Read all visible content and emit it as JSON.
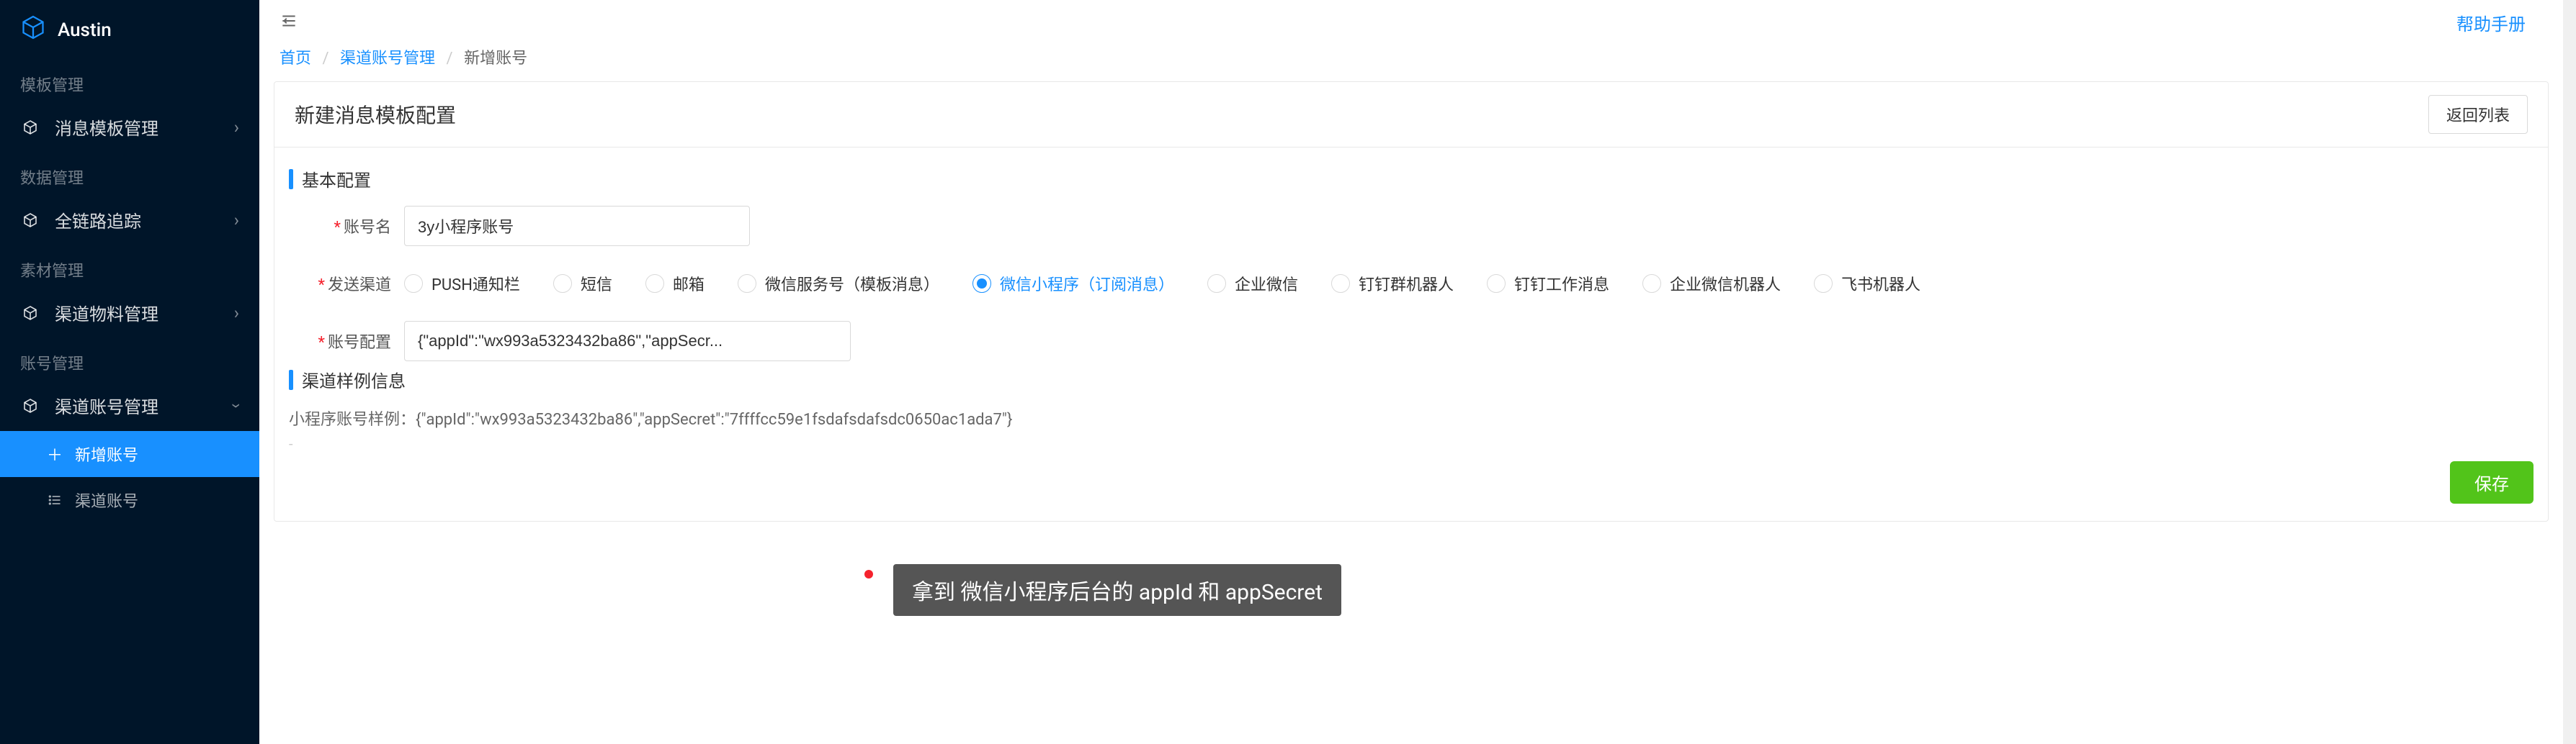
{
  "app_name": "Austin",
  "topbar": {
    "help": "帮助手册"
  },
  "breadcrumb": {
    "home": "首页",
    "mgmt": "渠道账号管理",
    "current": "新增账号"
  },
  "sidebar": {
    "groups": [
      {
        "label": "模板管理",
        "items": [
          {
            "icon": "cube",
            "label": "消息模板管理",
            "expandable": true
          }
        ]
      },
      {
        "label": "数据管理",
        "items": [
          {
            "icon": "cube",
            "label": "全链路追踪",
            "expandable": true
          }
        ]
      },
      {
        "label": "素材管理",
        "items": [
          {
            "icon": "cube",
            "label": "渠道物料管理",
            "expandable": true
          }
        ]
      },
      {
        "label": "账号管理",
        "items": [
          {
            "icon": "cube",
            "label": "渠道账号管理",
            "expandable": true,
            "expanded": true,
            "children": [
              {
                "icon": "plus",
                "label": "新增账号",
                "active": true
              },
              {
                "icon": "list",
                "label": "渠道账号"
              }
            ]
          }
        ]
      }
    ]
  },
  "panel": {
    "title": "新建消息模板配置",
    "back": "返回列表"
  },
  "form": {
    "section_basic": "基本配置",
    "account_name_label": "账号名",
    "account_name_value": "3y小程序账号",
    "channel_label": "发送渠道",
    "channels": [
      "PUSH通知栏",
      "短信",
      "邮箱",
      "微信服务号（模板消息）",
      "微信小程序（订阅消息）",
      "企业微信",
      "钉钉群机器人",
      "钉钉工作消息",
      "企业微信机器人",
      "飞书机器人"
    ],
    "channel_selected_index": 4,
    "config_label": "账号配置",
    "config_value": "{\"appId\":\"wx993a5323432ba86\",\"appSecr...",
    "section_sample": "渠道样例信息",
    "sample_text": "小程序账号样例：{\"appId\":\"wx993a5323432ba86\",\"appSecret\":\"7ffffcc59e1fsdafsdafsdc0650ac1ada7\"}",
    "save": "保存"
  },
  "tooltip": "拿到 微信小程序后台的 appId 和 appSecret"
}
